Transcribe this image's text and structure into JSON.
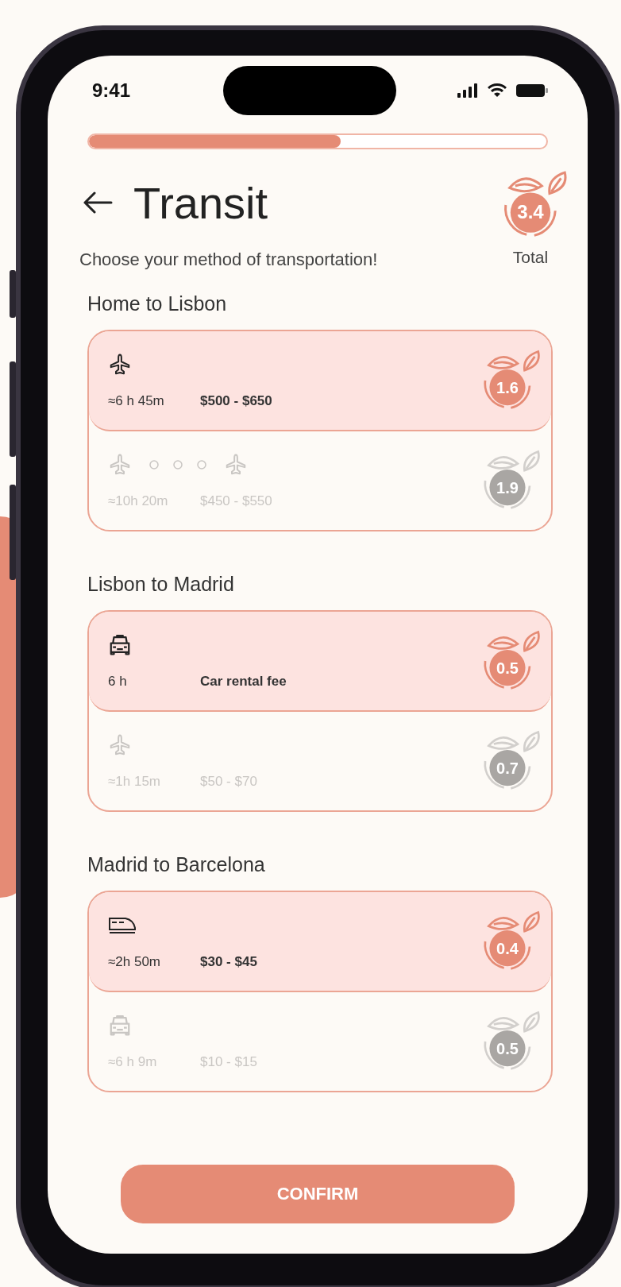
{
  "status_bar": {
    "time": "9:41"
  },
  "progress": {
    "level": 0.55
  },
  "header": {
    "title": "Transit",
    "subtitle": "Choose your method of transportation!",
    "total": {
      "score": "3.4",
      "label": "Total"
    }
  },
  "legs": [
    {
      "title": "Home to Lisbon",
      "options": [
        {
          "kind": "plane",
          "duration": "≈6 h 45m",
          "price": "$500 - $650",
          "score": "1.6",
          "selected": true
        },
        {
          "kind": "connecting-flight",
          "duration": "≈10h 20m",
          "price": "$450 - $550",
          "score": "1.9",
          "selected": false
        }
      ]
    },
    {
      "title": "Lisbon to Madrid",
      "options": [
        {
          "kind": "car",
          "duration": "6 h",
          "price": "Car rental fee",
          "score": "0.5",
          "selected": true
        },
        {
          "kind": "plane",
          "duration": "≈1h 15m",
          "price": "$50 - $70",
          "score": "0.7",
          "selected": false
        }
      ]
    },
    {
      "title": "Madrid to Barcelona",
      "options": [
        {
          "kind": "train",
          "duration": "≈2h 50m",
          "price": "$30 - $45",
          "score": "0.4",
          "selected": true
        },
        {
          "kind": "car",
          "duration": "≈6 h 9m",
          "price": "$10 - $15",
          "score": "0.5",
          "selected": false
        }
      ]
    }
  ],
  "confirm": {
    "label": "CONFIRM"
  }
}
